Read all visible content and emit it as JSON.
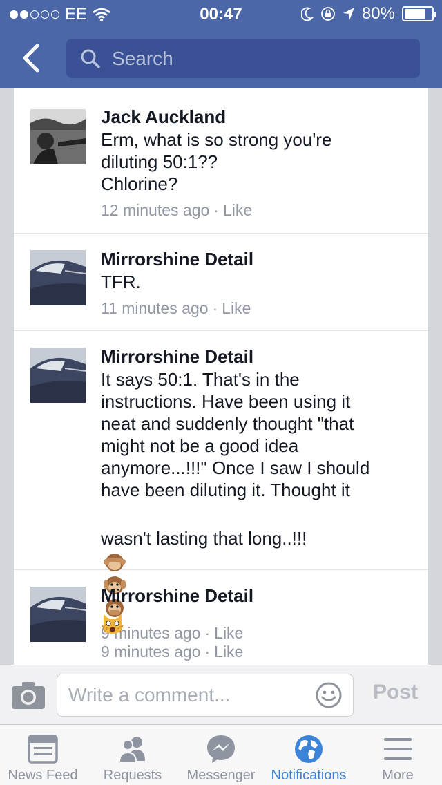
{
  "status_bar": {
    "carrier": "EE",
    "time": "00:47",
    "battery": "80%",
    "battery_level": 0.8
  },
  "nav": {
    "search_placeholder": "Search"
  },
  "comments": [
    {
      "author": "Jack Auckland",
      "text": "Erm, what is so strong you're\ndiluting 50:1??\nChlorine?",
      "time": "12 minutes ago",
      "like": "Like"
    },
    {
      "author": "Mirrorshine Detail",
      "text": "TFR.",
      "time": "11 minutes ago",
      "like": "Like"
    },
    {
      "author": "Mirrorshine Detail",
      "text": "It says 50:1. That's in the\ninstructions. Have been using it\nneat and suddenly thought \"that\nmight not be a good idea\nanymore...!!!\" Once I saw I should\nhave been diluting it. Thought it",
      "text_last_line": "wasn't lasting that long..!!!",
      "emoji": [
        "see-no-evil-monkey",
        "hear-no-evil-monkey",
        "speak-no-evil-monkey"
      ],
      "time": "9 minutes ago",
      "like": "Like"
    },
    {
      "author": "Mirrorshine Detail",
      "emoji": [
        "weary-cat-face"
      ],
      "time": "9 minutes ago",
      "like": "Like"
    }
  ],
  "composer": {
    "placeholder": "Write a comment...",
    "post_label": "Post"
  },
  "tabs": [
    {
      "label": "News Feed",
      "icon": "news-feed-icon"
    },
    {
      "label": "Requests",
      "icon": "friends-icon"
    },
    {
      "label": "Messenger",
      "icon": "messenger-icon"
    },
    {
      "label": "Notifications",
      "icon": "globe-icon",
      "active": true
    },
    {
      "label": "More",
      "icon": "menu-icon"
    }
  ],
  "colors": {
    "brand_blue": "#4b67a8",
    "active_tab": "#3b84d8",
    "meta_gray": "#9197a3"
  }
}
